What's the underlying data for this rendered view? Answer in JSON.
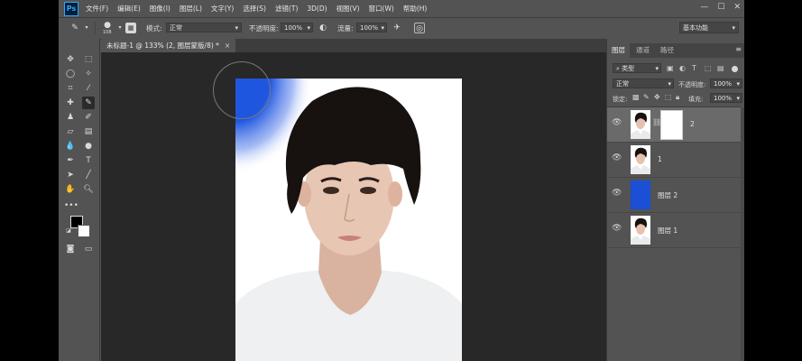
{
  "menu": {
    "logo": "Ps",
    "items": [
      "文件(F)",
      "编辑(E)",
      "图像(I)",
      "图层(L)",
      "文字(Y)",
      "选择(S)",
      "滤镜(T)",
      "3D(D)",
      "视图(V)",
      "窗口(W)",
      "帮助(H)"
    ],
    "controls": [
      "—",
      "☐",
      "✕"
    ]
  },
  "options": {
    "brush_size": "108",
    "mode_label": "模式:",
    "mode_value": "正常",
    "opacity_label": "不透明度:",
    "opacity_value": "100%",
    "flow_label": "流量:",
    "flow_value": "100%",
    "workspace": "基本功能"
  },
  "document": {
    "tab_title": "未标题-1 @ 133% (2, 图层蒙版/8) *",
    "tab_close": "×",
    "brush_color": "#1f56e0"
  },
  "panel": {
    "tabs": [
      "图层",
      "通道",
      "路径"
    ],
    "filter_value": "类型",
    "blend_mode": "正常",
    "opacity_label": "不透明度:",
    "opacity_value": "100%",
    "lock_label": "锁定:",
    "fill_label": "填充:",
    "fill_value": "100%",
    "layers": [
      {
        "name": "2",
        "has_mask": true,
        "selected": true
      },
      {
        "name": "1",
        "has_mask": false,
        "selected": false
      },
      {
        "name": "图层 2",
        "has_mask": false,
        "selected": false
      },
      {
        "name": "图层 1",
        "has_mask": false,
        "selected": false
      }
    ],
    "blue_layer_color": "#1a4fd6"
  },
  "tools": [
    "move-tool",
    "marquee-tool",
    "lasso-tool",
    "quick-select-tool",
    "crop-tool",
    "eyedropper-tool",
    "healing-tool",
    "brush-tool",
    "stamp-tool",
    "history-brush-tool",
    "eraser-tool",
    "gradient-tool",
    "blur-tool",
    "dodge-tool",
    "pen-tool",
    "type-tool",
    "path-select-tool",
    "line-tool",
    "hand-tool",
    "zoom-tool"
  ]
}
